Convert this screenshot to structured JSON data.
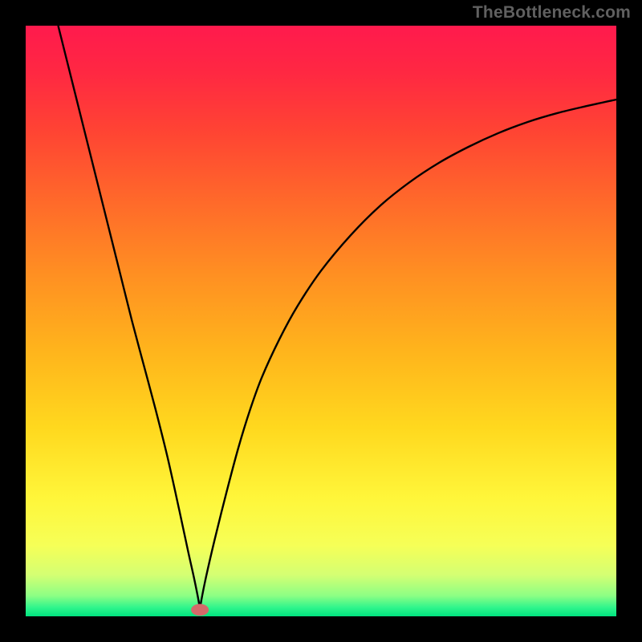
{
  "watermark": "TheBottleneck.com",
  "chart_data": {
    "type": "line",
    "title": "",
    "xlabel": "",
    "ylabel": "",
    "xlim": [
      0,
      100
    ],
    "ylim": [
      0,
      100
    ],
    "grid": false,
    "legend": false,
    "background": {
      "gradient_stops": [
        {
          "offset": 0.0,
          "color": "#ff1a4d"
        },
        {
          "offset": 0.08,
          "color": "#ff2842"
        },
        {
          "offset": 0.18,
          "color": "#ff4433"
        },
        {
          "offset": 0.3,
          "color": "#ff6a2a"
        },
        {
          "offset": 0.42,
          "color": "#ff8f22"
        },
        {
          "offset": 0.55,
          "color": "#ffb41c"
        },
        {
          "offset": 0.68,
          "color": "#ffd81e"
        },
        {
          "offset": 0.8,
          "color": "#fff63a"
        },
        {
          "offset": 0.88,
          "color": "#f6ff57"
        },
        {
          "offset": 0.93,
          "color": "#d4ff73"
        },
        {
          "offset": 0.965,
          "color": "#8dff84"
        },
        {
          "offset": 0.985,
          "color": "#30f58c"
        },
        {
          "offset": 1.0,
          "color": "#00e37f"
        }
      ]
    },
    "marker": {
      "x": 29.5,
      "y": 1.1,
      "color": "#d46a6a",
      "rx": 1.5,
      "ry": 1.0
    },
    "curve": {
      "x": [
        5.5,
        8,
        10,
        12,
        14,
        16,
        18,
        20,
        22,
        24,
        26,
        27.5,
        28.5,
        29.3,
        29.5,
        29.7,
        30.5,
        32,
        34,
        36,
        38,
        40,
        43,
        46,
        50,
        55,
        60,
        65,
        70,
        75,
        80,
        85,
        90,
        95,
        100
      ],
      "y": [
        100,
        90,
        82,
        74,
        66,
        58,
        50,
        42.5,
        35,
        27,
        18,
        11,
        6.5,
        2.5,
        1.0,
        2.5,
        6.5,
        13,
        21,
        28.5,
        35,
        40.5,
        47,
        52.5,
        58.5,
        64.5,
        69.5,
        73.5,
        76.8,
        79.5,
        81.8,
        83.7,
        85.2,
        86.4,
        87.5
      ]
    }
  }
}
